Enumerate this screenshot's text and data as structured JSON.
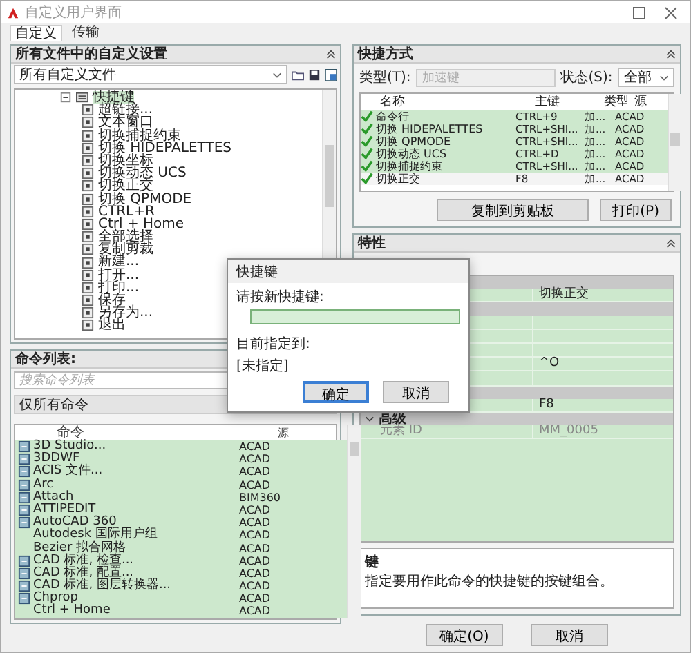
{
  "window": {
    "title": "自定义用户界面"
  },
  "tabs": [
    {
      "label": "自定义",
      "selected": true
    },
    {
      "label": "传输",
      "selected": false
    }
  ],
  "customizations_panel": {
    "title": "所有文件中的自定义设置",
    "file_select": "所有自定义文件",
    "tree": {
      "label": "快捷键",
      "expanded": true,
      "selected": true,
      "children": [
        {
          "label": "超链接..."
        },
        {
          "label": "文本窗口"
        },
        {
          "label": "切换捕捉约束"
        },
        {
          "label": "切换 HIDEPALETTES"
        },
        {
          "label": "切换坐标"
        },
        {
          "label": "切换动态 UCS"
        },
        {
          "label": "切换正交"
        },
        {
          "label": "切换 QPMODE"
        },
        {
          "label": "CTRL+R"
        },
        {
          "label": "Ctrl + Home"
        },
        {
          "label": "全部选择"
        },
        {
          "label": "复制剪裁"
        },
        {
          "label": "新建..."
        },
        {
          "label": "打开..."
        },
        {
          "label": "打印..."
        },
        {
          "label": "保存"
        },
        {
          "label": "另存为..."
        },
        {
          "label": "退出"
        }
      ]
    }
  },
  "command_list_panel": {
    "title": "命令列表:",
    "search": {
      "placeholder": "搜索命令列表"
    },
    "filter": "仅所有命令",
    "columns": [
      "命令",
      "源"
    ],
    "rows": [
      {
        "name": "3D Studio...",
        "source": "ACAD",
        "has_icon": true
      },
      {
        "name": "3DDWF",
        "source": "ACAD",
        "has_icon": true
      },
      {
        "name": "ACIS 文件...",
        "source": "ACAD",
        "has_icon": true
      },
      {
        "name": "Arc",
        "source": "ACAD",
        "has_icon": true
      },
      {
        "name": "Attach",
        "source": "BIM360",
        "has_icon": true
      },
      {
        "name": "ATTIPEDIT",
        "source": "ACAD",
        "has_icon": true
      },
      {
        "name": "AutoCAD 360",
        "source": "ACAD",
        "has_icon": true
      },
      {
        "name": "Autodesk 国际用户组",
        "source": "ACAD",
        "has_icon": false
      },
      {
        "name": "Bezier 拟合网格",
        "source": "ACAD",
        "has_icon": false
      },
      {
        "name": "CAD 标准, 检查...",
        "source": "ACAD",
        "has_icon": true
      },
      {
        "name": "CAD 标准, 配置...",
        "source": "ACAD",
        "has_icon": true
      },
      {
        "name": "CAD 标准, 图层转换器...",
        "source": "ACAD",
        "has_icon": true
      },
      {
        "name": "Chprop",
        "source": "ACAD",
        "has_icon": true
      },
      {
        "name": "Ctrl + Home",
        "source": "ACAD",
        "has_icon": false
      }
    ]
  },
  "shortcuts_panel": {
    "title": "快捷方式",
    "type_label": "类型(T):",
    "type_value": "加速键",
    "type_disabled": true,
    "status_label": "状态(S):",
    "status_value": "全部",
    "columns": [
      "名称",
      "主键",
      "类型",
      "源"
    ],
    "rows": [
      {
        "name": "命令行",
        "key": "CTRL+9",
        "type": "加...",
        "source": "ACAD",
        "selected": false
      },
      {
        "name": "切换 HIDEPALETTES",
        "key": "CTRL+SHI...",
        "type": "加...",
        "source": "ACAD",
        "selected": false
      },
      {
        "name": "切换 QPMODE",
        "key": "CTRL+SHI...",
        "type": "加...",
        "source": "ACAD",
        "selected": false
      },
      {
        "name": "切换动态 UCS",
        "key": "CTRL+D",
        "type": "加...",
        "source": "ACAD",
        "selected": false
      },
      {
        "name": "切换捕捉约束",
        "key": "CTRL+SHI...",
        "type": "加...",
        "source": "ACAD",
        "selected": false
      },
      {
        "name": "切换正交",
        "key": "F8",
        "type": "加...",
        "source": "ACAD",
        "selected": true
      }
    ],
    "buttons": [
      "复制到剪贴板",
      "打印(P)"
    ]
  },
  "properties_panel": {
    "title": "特性",
    "rows": [
      {
        "kind": "category"
      },
      {
        "kind": "property",
        "value": "切换正交"
      },
      {
        "kind": "category"
      },
      {
        "kind": "property"
      },
      {
        "kind": "property"
      },
      {
        "kind": "property"
      },
      {
        "kind": "property",
        "value": "^O"
      },
      {
        "kind": "property"
      },
      {
        "kind": "category"
      },
      {
        "kind": "property",
        "value": "F8"
      },
      {
        "kind": "category",
        "label": "高级",
        "expanded": true
      },
      {
        "kind": "property",
        "name": "元素 ID",
        "value": "MM_0005",
        "disabled": true
      }
    ],
    "description": {
      "title": "键",
      "text": "指定要用作此命令的快捷键的按键组合。"
    }
  },
  "buttons": [
    "确定(O)",
    "取消"
  ],
  "dialog": {
    "title": "快捷键",
    "prompt": "请按新快捷键:",
    "assigned_label": "目前指定到:",
    "assigned_value": "[未指定]",
    "buttons": [
      {
        "label": "确定",
        "default": true
      },
      {
        "label": "取消",
        "default": false
      }
    ]
  }
}
